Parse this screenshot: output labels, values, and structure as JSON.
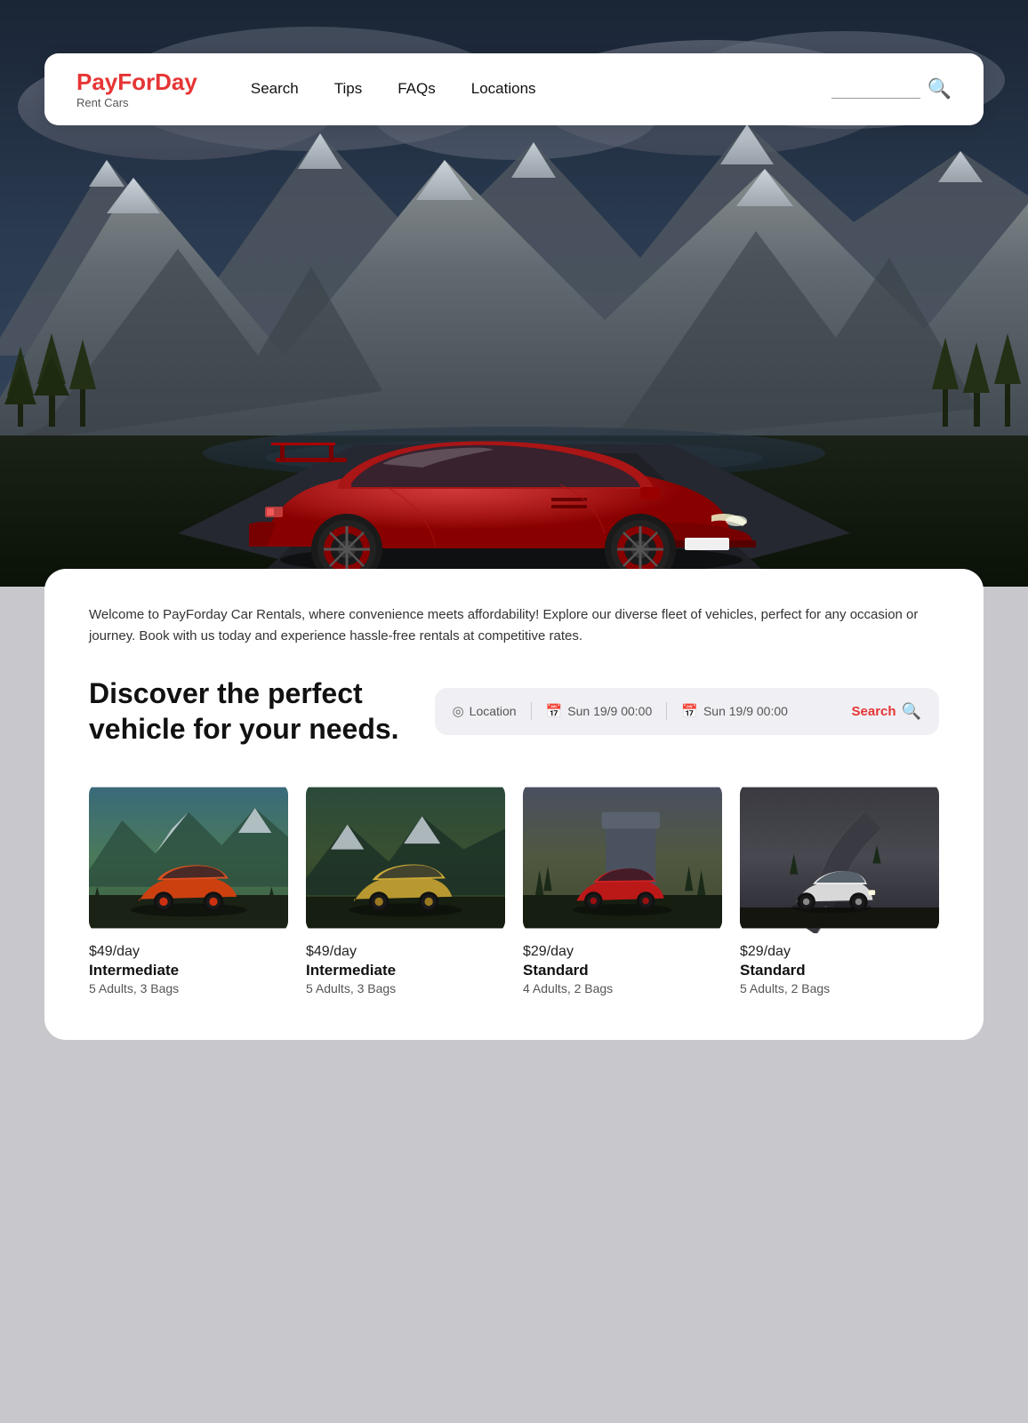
{
  "brand": {
    "name_part1": "PayFor",
    "name_part2": "Day",
    "subtitle": "Rent Cars"
  },
  "nav": {
    "links": [
      {
        "label": "Search",
        "href": "#"
      },
      {
        "label": "Tips",
        "href": "#"
      },
      {
        "label": "FAQs",
        "href": "#"
      },
      {
        "label": "Locations",
        "href": "#"
      }
    ],
    "search_placeholder": ""
  },
  "hero": {
    "welcome_text": "Welcome to PayForday Car Rentals, where convenience meets affordability! Explore our diverse fleet of vehicles, perfect for any occasion or journey. Book with us today and experience hassle-free rentals at competitive rates.",
    "heading_line1": "Discover the perfect",
    "heading_line2": "vehicle for your needs."
  },
  "search_bar": {
    "location_label": "Location",
    "date1_label": "Sun 19/9 00:00",
    "date2_label": "Sun 19/9 00:00",
    "search_label": "Search"
  },
  "cars": [
    {
      "price": "$49/day",
      "name": "Intermediate",
      "specs": "5 Adults, 3 Bags",
      "color_primary": "#e05a20",
      "color_secondary": "#cc4400",
      "bg_gradient": [
        "#3a5a6a",
        "#4a7a5a",
        "#5a8a4a"
      ]
    },
    {
      "price": "$49/day",
      "name": "Intermediate",
      "specs": "5 Adults, 3 Bags",
      "color_primary": "#d4b860",
      "color_secondary": "#c0a040",
      "bg_gradient": [
        "#2a4a3a",
        "#3a5a2a",
        "#4a5030"
      ]
    },
    {
      "price": "$29/day",
      "name": "Standard",
      "specs": "4 Adults, 2 Bags",
      "color_primary": "#cc2020",
      "color_secondary": "#aa1010",
      "bg_gradient": [
        "#4a5060",
        "#3a6050",
        "#5a5040"
      ]
    },
    {
      "price": "$29/day",
      "name": "Standard",
      "specs": "5 Adults, 2 Bags",
      "color_primary": "#e0e0e0",
      "color_secondary": "#c0c0c0",
      "bg_gradient": [
        "#3a3a40",
        "#4a4a50",
        "#2a3040"
      ]
    }
  ]
}
